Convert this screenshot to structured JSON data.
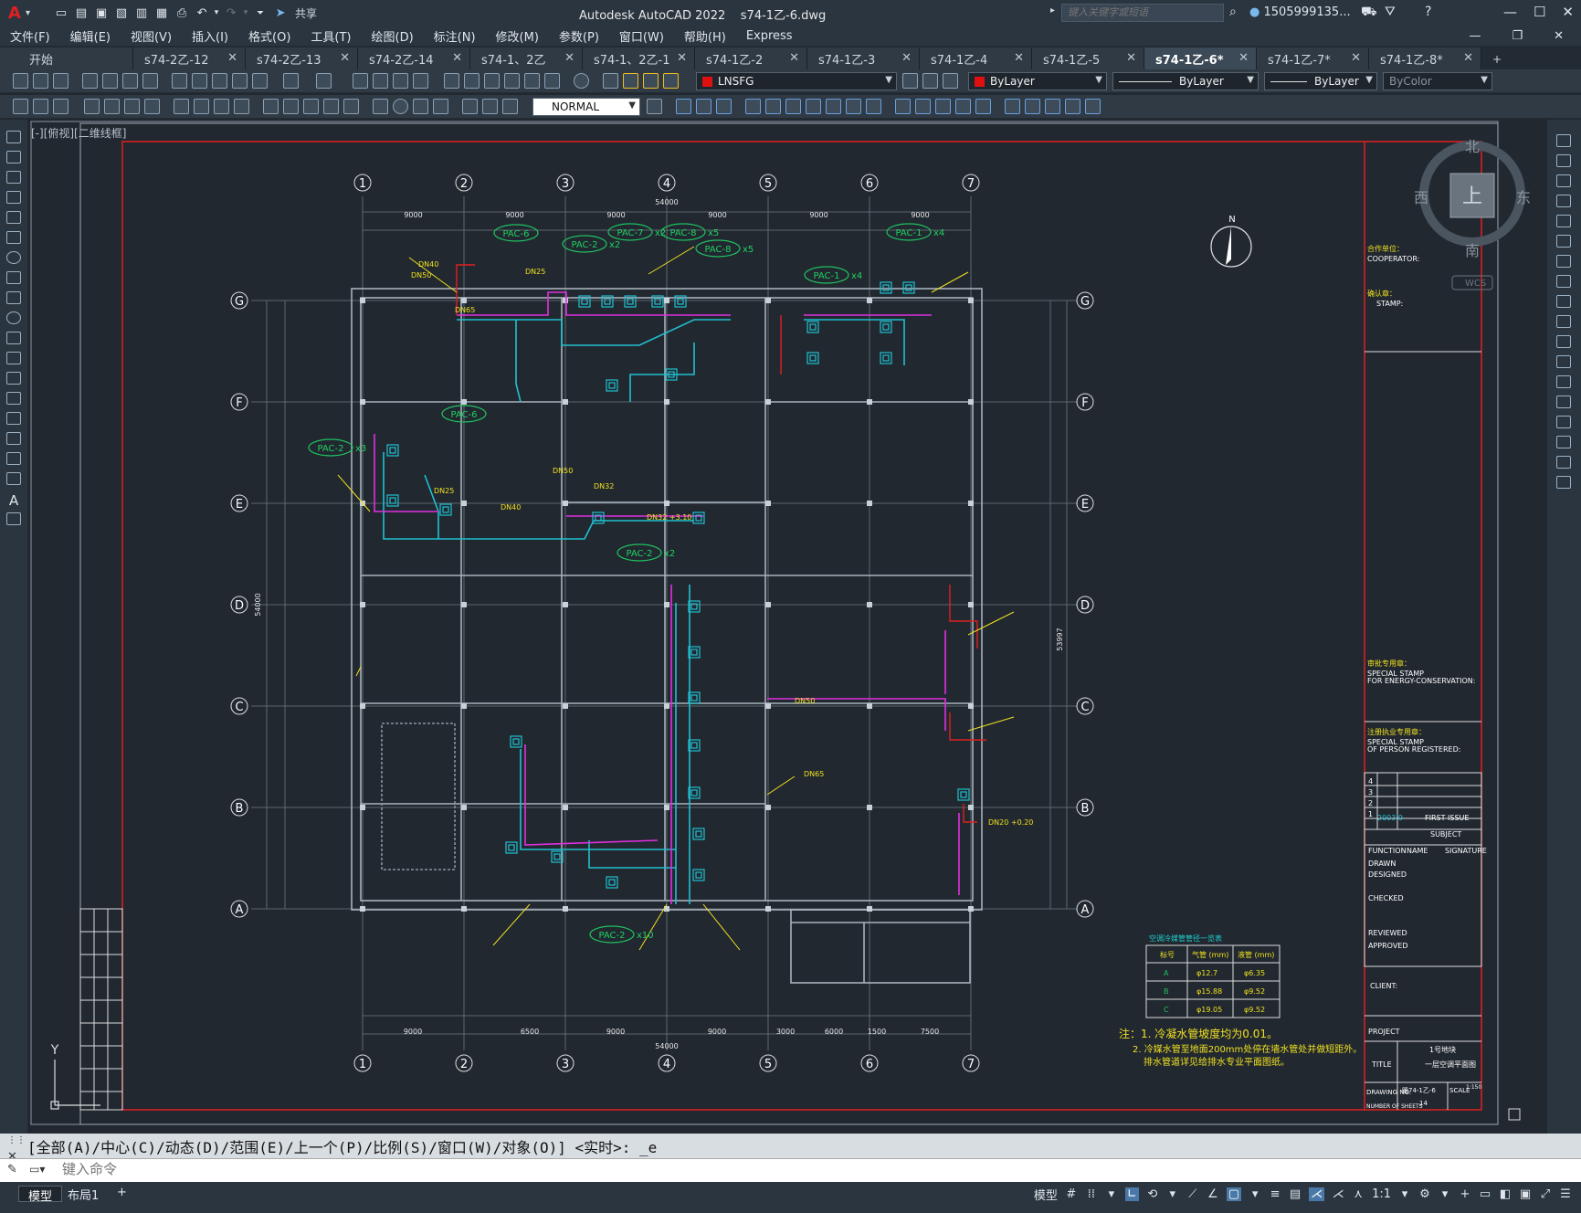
{
  "app": {
    "title": "Autodesk AutoCAD 2022",
    "file": "s74-1乙-6.dwg",
    "logo": "A"
  },
  "quick_access": {
    "share_label": "共享"
  },
  "search": {
    "placeholder": "键入关键字或短语"
  },
  "user": {
    "name": "1505999135..."
  },
  "menu": [
    "文件(F)",
    "编辑(E)",
    "视图(V)",
    "插入(I)",
    "格式(O)",
    "工具(T)",
    "绘图(D)",
    "标注(N)",
    "修改(M)",
    "参数(P)",
    "窗口(W)",
    "帮助(H)",
    "Express"
  ],
  "tabs": [
    {
      "label": "开始"
    },
    {
      "label": "s74-2乙-12"
    },
    {
      "label": "s74-2乙-13"
    },
    {
      "label": "s74-2乙-14"
    },
    {
      "label": "s74-1、2乙"
    },
    {
      "label": "s74-1、2乙-1"
    },
    {
      "label": "s74-1乙-2"
    },
    {
      "label": "s74-1乙-3"
    },
    {
      "label": "s74-1乙-4"
    },
    {
      "label": "s74-1乙-5"
    },
    {
      "label": "s74-1乙-6*"
    },
    {
      "label": "s74-1乙-7*"
    },
    {
      "label": "s74-1乙-8*"
    }
  ],
  "active_tab": "s74-1乙-6*",
  "toolbar": {
    "layer": "LNSFG",
    "color": "ByLayer",
    "linetype": "ByLayer",
    "lineweight": "ByLayer",
    "plotstyle": "ByColor",
    "textstyle": "NORMAL"
  },
  "viewport": {
    "label": "[-][俯视][二维线框]"
  },
  "viewcube": {
    "north": "北",
    "south": "南",
    "east": "东",
    "west": "西",
    "top": "上",
    "wcs": "WCS"
  },
  "drawing": {
    "grid_columns": [
      "1",
      "2",
      "3",
      "4",
      "5",
      "6",
      "7"
    ],
    "grid_rows": [
      "G",
      "F",
      "E",
      "D",
      "C",
      "B",
      "A"
    ],
    "top_dims": [
      "9000",
      "9000",
      "9000",
      "9000",
      "9000",
      "9000"
    ],
    "top_total": "54000",
    "bottom_dims": [
      "9000",
      "6500",
      "9000",
      "9000",
      "3000",
      "6000",
      "1500",
      "7500"
    ],
    "bottom_total": "54000",
    "left_total": "54000",
    "right_total": "53997",
    "pac_labels": [
      "PAC-6",
      "PAC-2",
      "PAC-7",
      "PAC-8",
      "PAC-8",
      "PAC-1",
      "PAC-1",
      "PAC-6",
      "PAC-2",
      "PAC-2",
      "PAC-2"
    ],
    "pac_counts": [
      "",
      "x2",
      "x2",
      "x5",
      "x5",
      "x4",
      "x4",
      "",
      "x3",
      "x2",
      "x10"
    ],
    "pipe_labels": [
      "DN40",
      "DN50",
      "DN25",
      "DN65",
      "DN32",
      "DN40",
      "DN50",
      "DN25",
      "DN50",
      "DN65",
      "DN20 +0.20",
      "DN32 +3.10"
    ],
    "north": "N",
    "notes": [
      "注：1. 冷凝水管坡度均为0.01。",
      "2. 冷媒水管至地面200mm处停在墙水管处并做短距外。",
      "排水管道详见给排水专业平面图纸。"
    ],
    "table": {
      "title": "空调冷媒管管径一览表",
      "headers": [
        "标号",
        "气管 (mm)",
        "液管 (mm)"
      ],
      "rows": [
        [
          "A",
          "φ12.7",
          "φ6.35"
        ],
        [
          "B",
          "φ15.88",
          "φ9.52"
        ],
        [
          "C",
          "φ19.05",
          "φ9.52"
        ]
      ]
    },
    "title_block": {
      "cooperator_cn": "合作单位：",
      "cooperator_en": "COOPERATOR:",
      "stamp_cn": "确认章：",
      "stamp_en": "STAMP:",
      "energy_cn": "审批专用章：",
      "energy_en1": "SPECIAL STAMP",
      "energy_en2": "FOR ENERGY-CONSERVATION:",
      "person_cn": "注册执业专用章：",
      "person_en1": "SPECIAL STAMP",
      "person_en2": "OF PERSON REGISTERED:",
      "revisions": [
        "4",
        "3",
        "2",
        "1"
      ],
      "rev1": "2003.9",
      "rev1_desc": "FIRST ISSUE",
      "subject": "SUBJECT",
      "function": "FUNCTION",
      "name": "NAME",
      "signature": "SIGNATURE",
      "drawn": "DRAWN",
      "designed": "DESIGNED",
      "checked": "CHECKED",
      "reviewed": "REVIEWED",
      "approved": "APPROVED",
      "client": "CLIENT:",
      "project": "PROJECT",
      "title": "TITLE",
      "title_value": "1号地块",
      "title_sub": "一层空调平面图",
      "drawing_no": "DRAWING NO.",
      "drawing_no_value": "暖74-1乙-6",
      "scale": "SCALE",
      "scale_value": "1:150",
      "sheets": "NUMBER OF SHEETS",
      "sheets_value": "14"
    },
    "ucs": {
      "y": "Y"
    }
  },
  "command": {
    "history": "[全部(A)/中心(C)/动态(D)/范围(E)/上一个(P)/比例(S)/窗口(W)/对象(O)] <实时>: _e",
    "placeholder": "键入命令"
  },
  "layouts": [
    {
      "label": "模型"
    },
    {
      "label": "布局1"
    }
  ],
  "status": {
    "model": "模型",
    "scale": "1:1"
  }
}
